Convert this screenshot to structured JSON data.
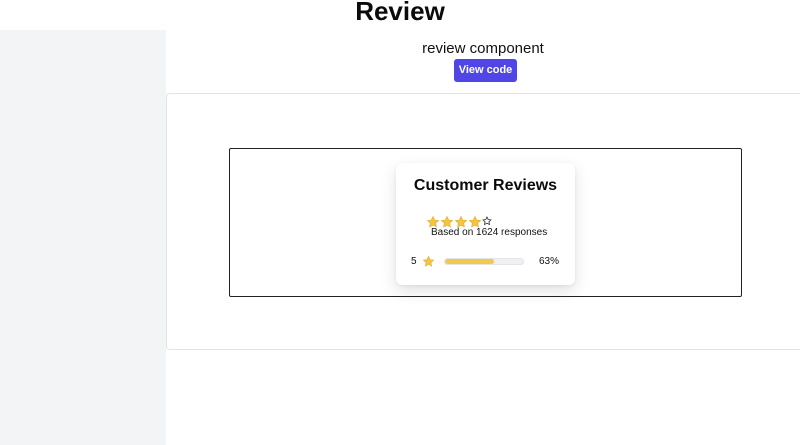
{
  "page": {
    "title": "Review"
  },
  "header": {
    "subtitle": "review component",
    "view_code_label": "View code"
  },
  "review_card": {
    "title": "Customer Reviews",
    "stars": [
      {
        "icon": "star-filled-icon"
      },
      {
        "icon": "star-filled-icon"
      },
      {
        "icon": "star-filled-icon"
      },
      {
        "icon": "star-filled-icon"
      },
      {
        "icon": "star-empty-icon"
      }
    ],
    "rating_out_of_5": 4,
    "responses_text": "Based on 1624 responses",
    "breakdown": {
      "label": "5",
      "icon": "star-filled-icon",
      "fraction": 0.63,
      "percent_text": "63%"
    }
  },
  "colors": {
    "accent": "#4f46e5",
    "star": "#f5c542",
    "progress": "#f2c94c",
    "sidebar": "#f3f4f6"
  }
}
